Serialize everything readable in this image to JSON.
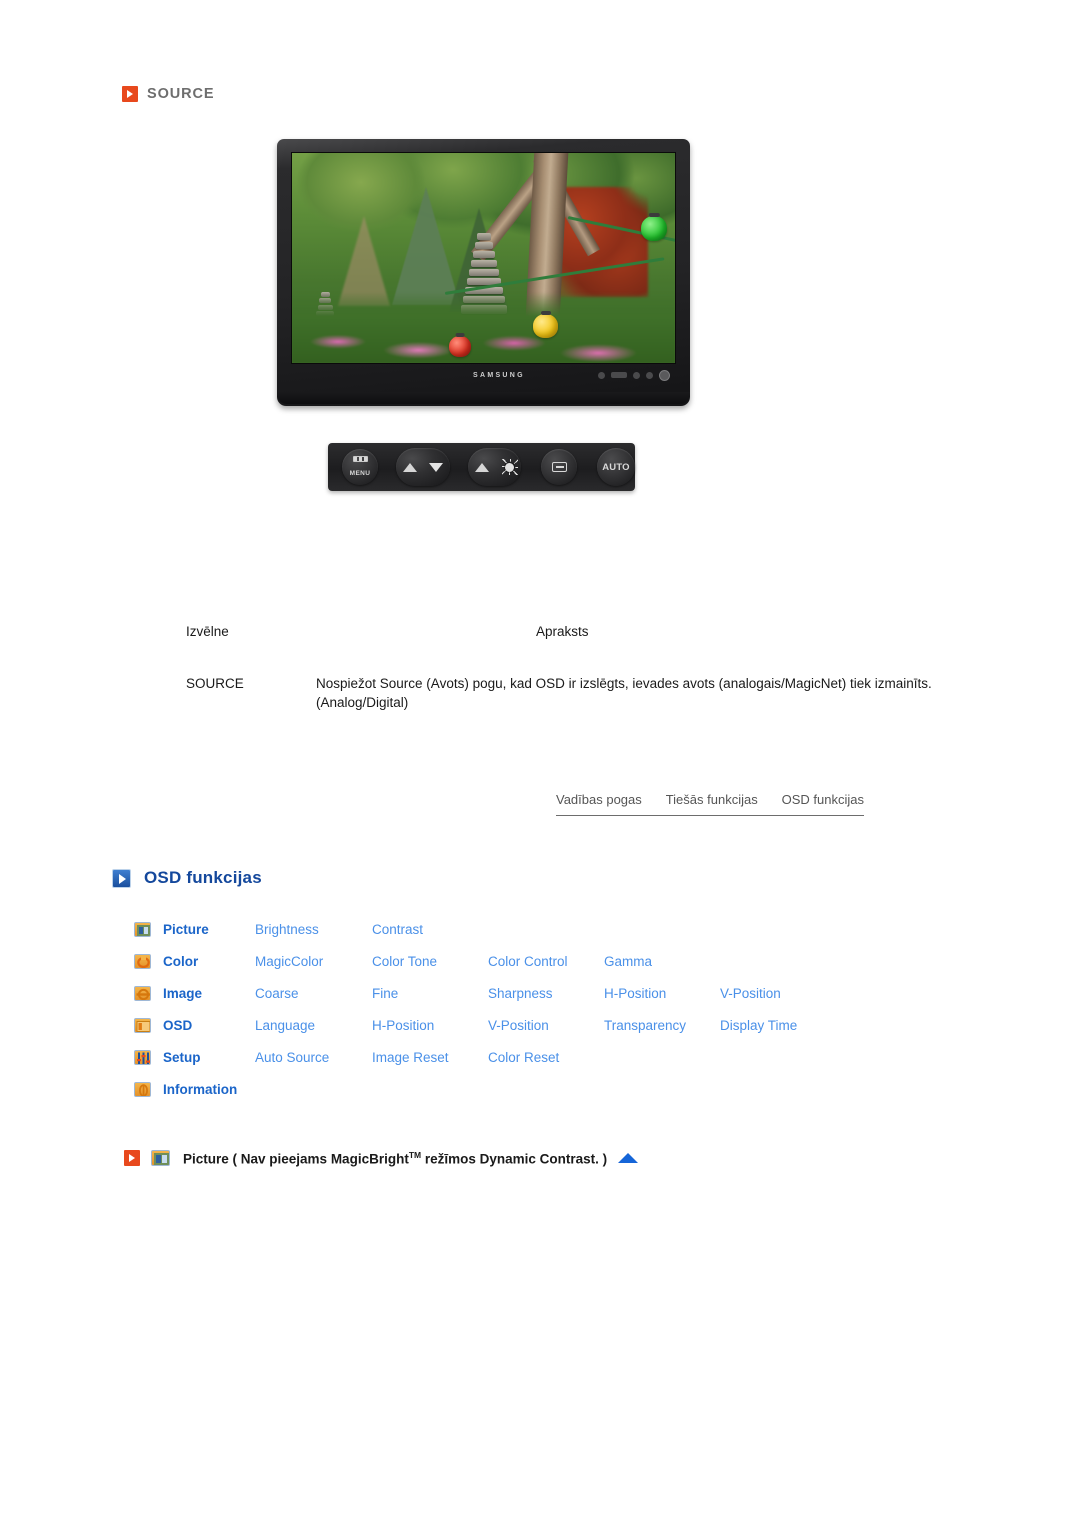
{
  "source_section": {
    "bullet_icon": "orange-play-bullet-icon",
    "title": "SOURCE"
  },
  "monitor": {
    "brand_logo": "SAMSUNG",
    "screen_image_alt": "garden-photo-with-pagoda-and-lanterns"
  },
  "control_buttons": [
    {
      "name": "menu-button",
      "label": "MENU",
      "icon": "menu-bars-icon"
    },
    {
      "name": "brightness-down-button",
      "label": "",
      "icon": "mountain-caret-down-icon"
    },
    {
      "name": "brightness-up-button",
      "label": "",
      "icon": "mountain-sun-icon"
    },
    {
      "name": "enter-button",
      "label": "",
      "icon": "enter-icon"
    },
    {
      "name": "auto-button",
      "label": "AUTO",
      "icon": "auto-text-icon"
    }
  ],
  "description_table": {
    "headers": {
      "menu": "Izvēlne",
      "description": "Apraksts"
    },
    "rows": [
      {
        "menu": "SOURCE",
        "description": "Nospiežot Source (Avots) pogu, kad OSD ir izslēgts, ievades avots (analogais/MagicNet) tiek izmainīts. (Analog/Digital)"
      }
    ]
  },
  "tabs": [
    {
      "label": "Vadības pogas"
    },
    {
      "label": "Tiešās funkcijas"
    },
    {
      "label": "OSD funkcijas"
    }
  ],
  "osd_section": {
    "bullet_icon": "blue-play-bullet-icon",
    "title": "OSD funkcijas"
  },
  "menu_matrix": {
    "rows": [
      {
        "icon": "picture-icon",
        "category": "Picture",
        "items": [
          "Brightness",
          "Contrast"
        ]
      },
      {
        "icon": "color-icon",
        "category": "Color",
        "items": [
          "MagicColor",
          "Color Tone",
          "Color Control",
          "Gamma"
        ]
      },
      {
        "icon": "image-icon",
        "category": "Image",
        "items": [
          "Coarse",
          "Fine",
          "Sharpness",
          "H-Position",
          "V-Position"
        ]
      },
      {
        "icon": "osd-icon",
        "category": "OSD",
        "items": [
          "Language",
          "H-Position",
          "V-Position",
          "Transparency",
          "Display Time"
        ]
      },
      {
        "icon": "setup-icon",
        "category": "Setup",
        "items": [
          "Auto Source",
          "Image Reset",
          "Color Reset"
        ]
      },
      {
        "icon": "information-icon",
        "category": "Information",
        "items": []
      }
    ]
  },
  "picture_note": {
    "bullet_icon": "orange-play-bullet-icon",
    "menu_icon": "picture-icon",
    "text_before": "Picture ( Nav pieejams MagicBright",
    "superscript": "TM",
    "text_after": " režīmos Dynamic Contrast. )",
    "scroll_top_icon": "blue-up-triangle-icon"
  },
  "colors": {
    "orange_bullet": "#e8491d",
    "blue_bullet": "#1a4f9e",
    "heading_blue": "#14489c",
    "category_blue": "#1b65c9",
    "item_blue": "#4a90e8",
    "source_gray": "#6e6e6e",
    "tab_gray": "#555555",
    "icon_orange": "#e4922a"
  }
}
